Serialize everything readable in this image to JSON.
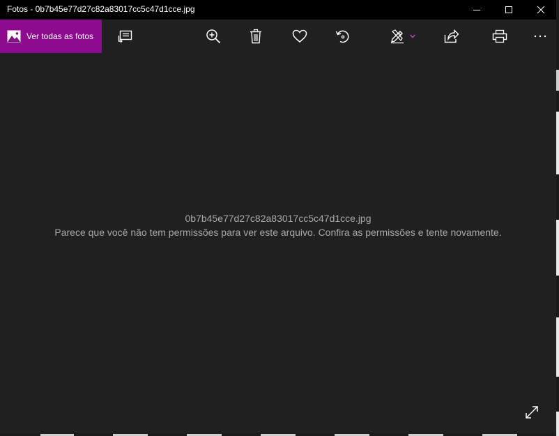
{
  "window": {
    "title": "Fotos - 0b7b45e77d27c82a83017cc5c47d1cce.jpg",
    "controls": [
      "minimize-icon",
      "maximize-icon",
      "close-icon"
    ]
  },
  "toolbar": {
    "see_all_label": "Ver todas as fotos",
    "accent_color": "#8c0b8f",
    "buttons": [
      {
        "icon": "slideshow-icon"
      },
      {
        "icon": "zoom-in-icon"
      },
      {
        "icon": "delete-icon"
      },
      {
        "icon": "heart-icon"
      },
      {
        "icon": "rotate-icon"
      },
      {
        "icon": "edit-draw-icon"
      },
      {
        "icon": "share-icon"
      },
      {
        "icon": "print-icon"
      },
      {
        "icon": "more-icon"
      }
    ]
  },
  "main": {
    "file_name": "0b7b45e77d27c82a83017cc5c47d1cce.jpg",
    "error_message": "Parece que você não tem permissões para ver este arquivo. Confira as permissões e tente novamente.",
    "fullscreen_icon": "fullscreen-icon"
  }
}
